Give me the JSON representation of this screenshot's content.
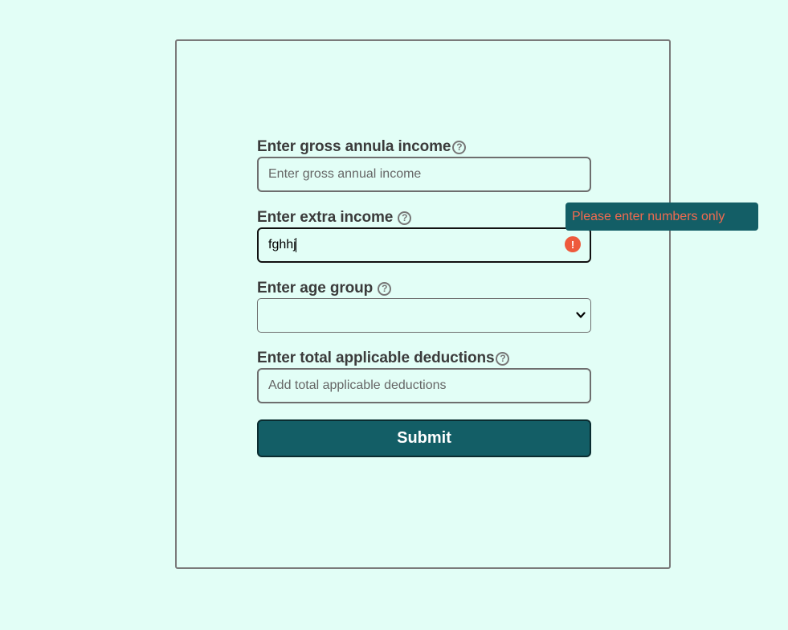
{
  "form": {
    "gross_income": {
      "label": "Enter gross annula income",
      "help_icon": "question-circle-icon",
      "placeholder": "Enter gross annual income",
      "value": ""
    },
    "extra_income": {
      "label": "Enter extra income",
      "help_icon": "question-circle-icon",
      "placeholder": "",
      "value": "fghhj",
      "error_icon": "exclamation-circle-icon",
      "error_tooltip": "Please enter numbers only"
    },
    "age_group": {
      "label": "Enter age group",
      "help_icon": "question-circle-icon",
      "selected": "",
      "dropdown_icon": "chevron-down-icon"
    },
    "deductions": {
      "label": "Enter total applicable deductions",
      "help_icon": "question-circle-icon",
      "placeholder": "Add total applicable deductions",
      "value": ""
    },
    "submit_label": "Submit"
  },
  "colors": {
    "background": "#e2fef6",
    "primary": "#135e66",
    "error": "#ee5a3c",
    "label_text": "#3b3b3b"
  }
}
